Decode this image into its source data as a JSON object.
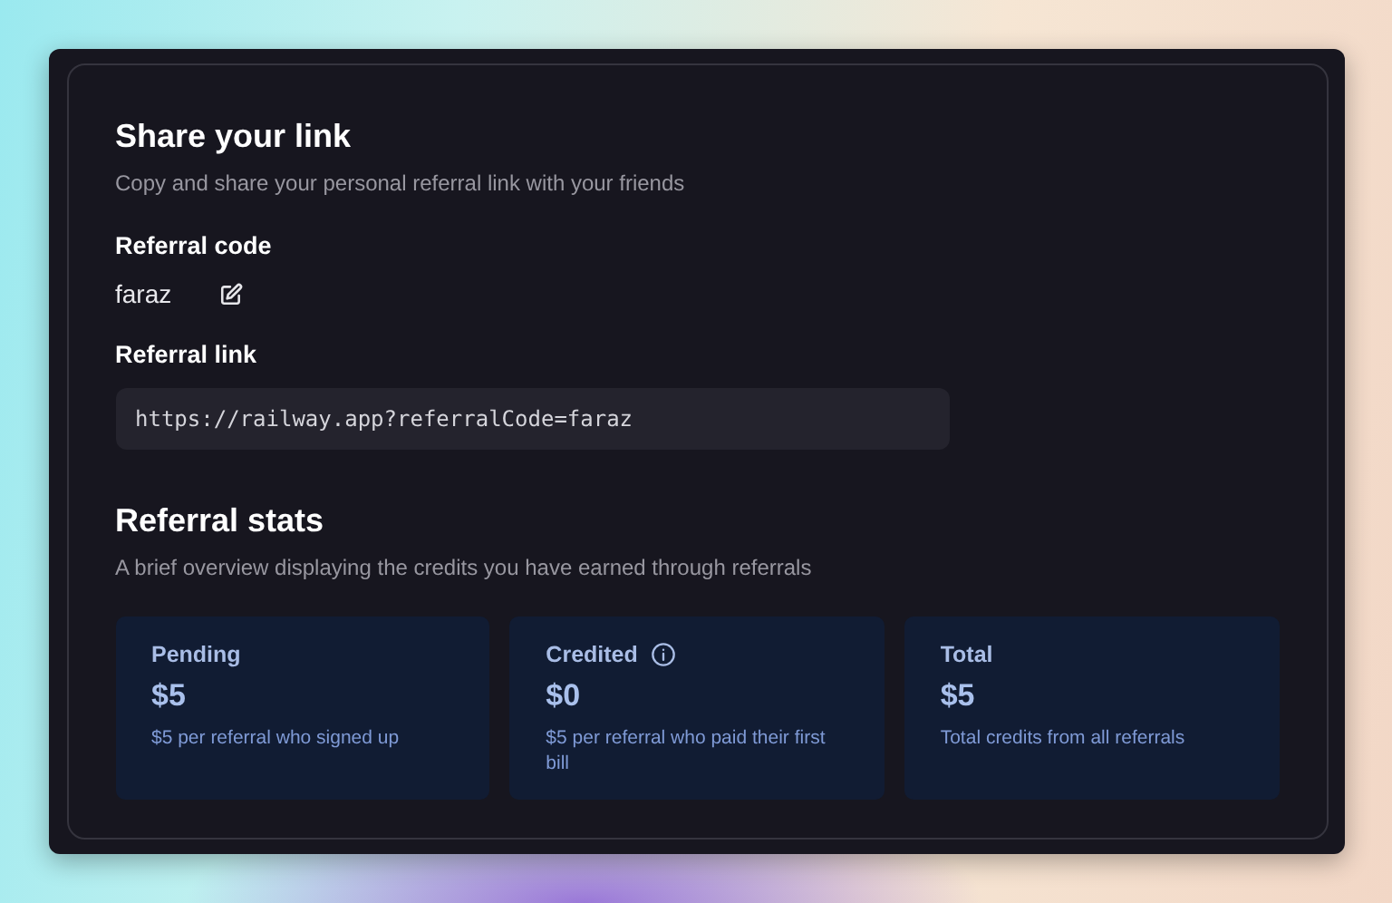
{
  "share": {
    "title": "Share your link",
    "subtitle": "Copy and share your personal referral link with your friends"
  },
  "code": {
    "label": "Referral code",
    "value": "faraz"
  },
  "link": {
    "label": "Referral link",
    "value": "https://railway.app?referralCode=faraz"
  },
  "stats": {
    "title": "Referral stats",
    "subtitle": "A brief overview displaying the credits you have earned through referrals",
    "cards": [
      {
        "label": "Pending",
        "info": false,
        "amount": "$5",
        "note": "$5 per referral who signed up"
      },
      {
        "label": "Credited",
        "info": true,
        "amount": "$0",
        "note": "$5 per referral who paid their first bill"
      },
      {
        "label": "Total",
        "info": false,
        "amount": "$5",
        "note": "Total credits from all referrals"
      }
    ]
  }
}
